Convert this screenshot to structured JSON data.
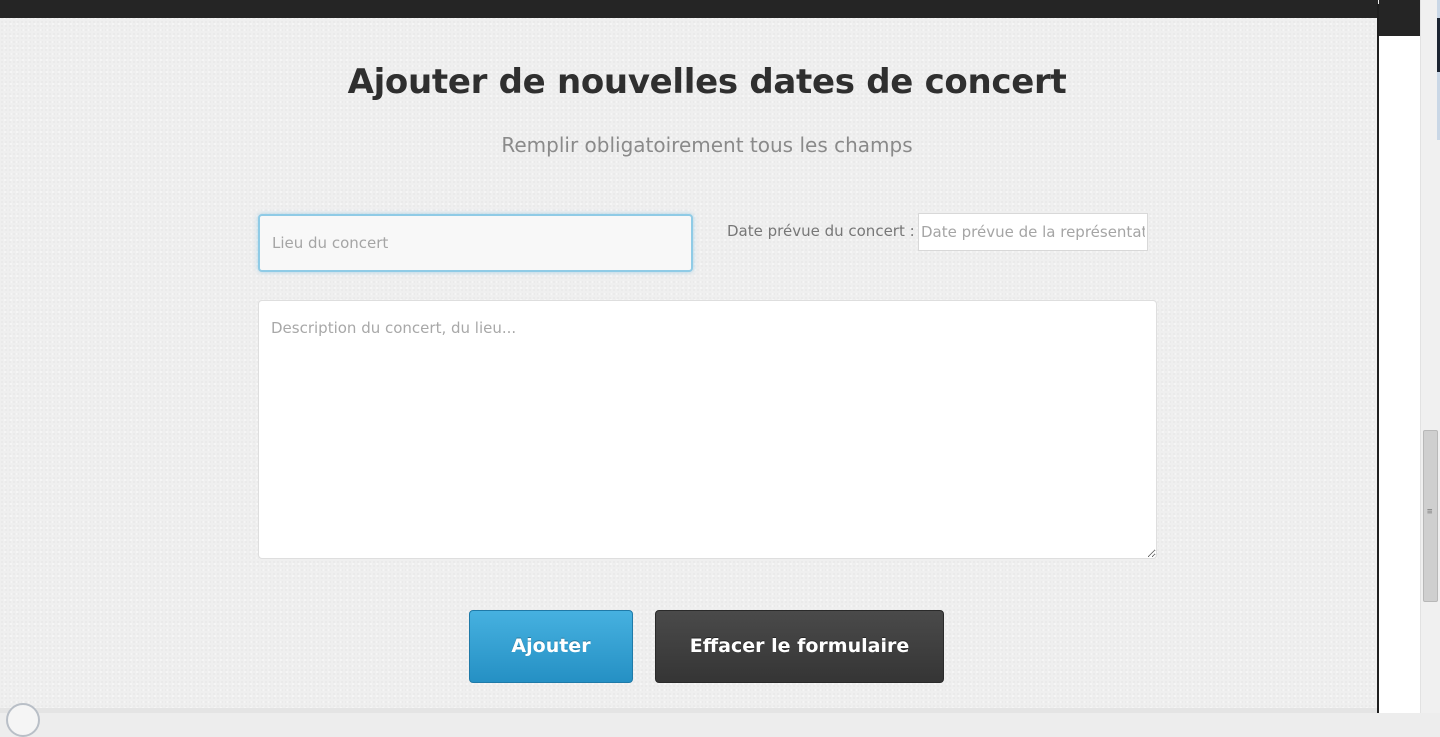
{
  "form": {
    "title": "Ajouter de nouvelles dates de concert",
    "subtitle": "Remplir obligatoirement tous les champs",
    "venue_placeholder": "Lieu du concert",
    "venue_value": "",
    "date_label": "Date prévue du concert :",
    "date_placeholder": "Date prévue de la représentation",
    "date_value": "",
    "description_placeholder": "Description du concert, du lieu...",
    "description_value": ""
  },
  "buttons": {
    "add_label": "Ajouter",
    "clear_label": "Effacer le formulaire"
  },
  "colors": {
    "add_button": "#2e9fd4",
    "clear_button": "#3d3d3d",
    "focus_border": "#8fcbe6",
    "topbar": "#252525"
  }
}
